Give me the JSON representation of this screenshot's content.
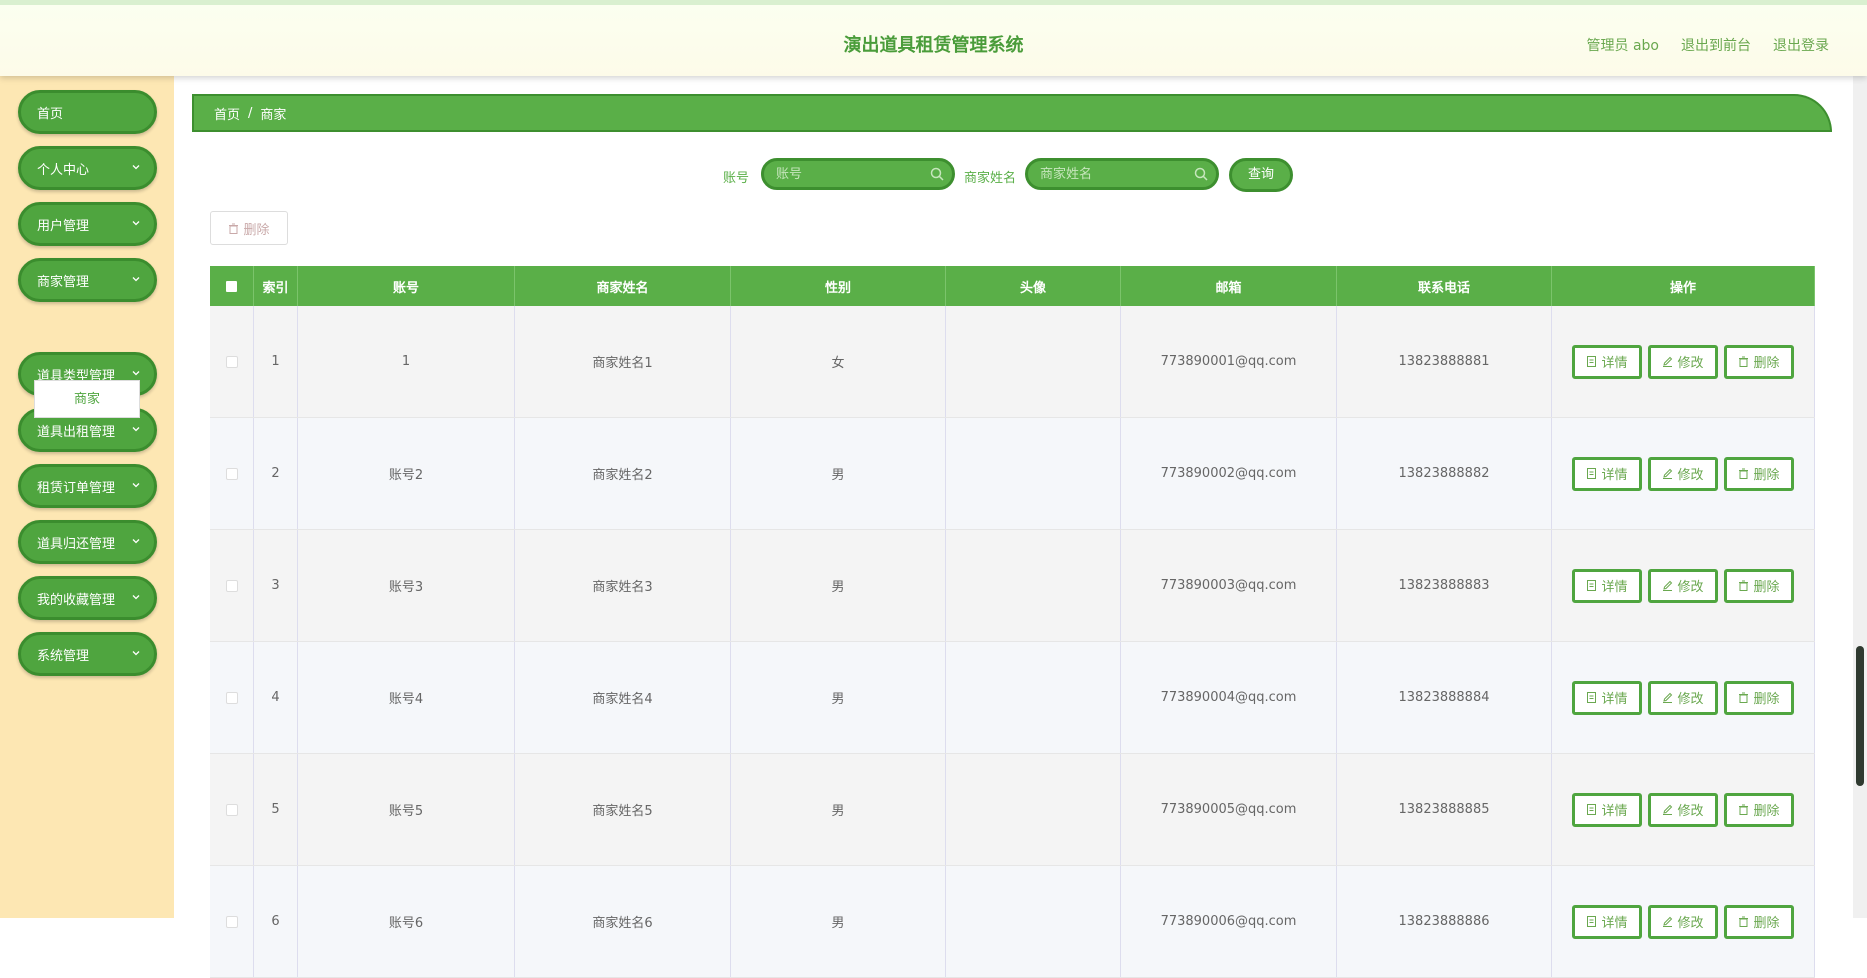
{
  "header": {
    "title": "演出道具租赁管理系统",
    "user_label": "管理员 abo",
    "front_link": "退出到前台",
    "logout_link": "退出登录"
  },
  "sidebar": {
    "items": [
      {
        "label": "首页",
        "has_arrow": false
      },
      {
        "label": "个人中心",
        "has_arrow": true
      },
      {
        "label": "用户管理",
        "has_arrow": true
      },
      {
        "label": "商家管理",
        "has_arrow": true
      },
      {
        "label": "道具类型管理",
        "has_arrow": true
      },
      {
        "label": "道具出租管理",
        "has_arrow": true
      },
      {
        "label": "租赁订单管理",
        "has_arrow": true
      },
      {
        "label": "道具归还管理",
        "has_arrow": true
      },
      {
        "label": "我的收藏管理",
        "has_arrow": true
      },
      {
        "label": "系统管理",
        "has_arrow": true
      }
    ],
    "submenu_label": "商家"
  },
  "breadcrumb": {
    "home": "首页",
    "sep": "/",
    "current": "商家"
  },
  "search": {
    "account_label": "账号",
    "account_placeholder": "账号",
    "name_label": "商家姓名",
    "name_placeholder": "商家姓名",
    "query_button": "查询"
  },
  "toolbar": {
    "delete_label": "删除"
  },
  "table": {
    "headers": [
      "索引",
      "账号",
      "商家姓名",
      "性别",
      "头像",
      "邮箱",
      "联系电话",
      "操作"
    ],
    "rows": [
      {
        "index": "1",
        "account": "1",
        "name": "商家姓名1",
        "gender": "女",
        "email": "773890001@qq.com",
        "phone": "13823888881"
      },
      {
        "index": "2",
        "account": "账号2",
        "name": "商家姓名2",
        "gender": "男",
        "email": "773890002@qq.com",
        "phone": "13823888882"
      },
      {
        "index": "3",
        "account": "账号3",
        "name": "商家姓名3",
        "gender": "男",
        "email": "773890003@qq.com",
        "phone": "13823888883"
      },
      {
        "index": "4",
        "account": "账号4",
        "name": "商家姓名4",
        "gender": "男",
        "email": "773890004@qq.com",
        "phone": "13823888884"
      },
      {
        "index": "5",
        "account": "账号5",
        "name": "商家姓名5",
        "gender": "男",
        "email": "773890005@qq.com",
        "phone": "13823888885"
      },
      {
        "index": "6",
        "account": "账号6",
        "name": "商家姓名6",
        "gender": "男",
        "email": "773890006@qq.com",
        "phone": "13823888886"
      }
    ],
    "actions": {
      "detail": "详情",
      "edit": "修改",
      "delete": "删除"
    }
  },
  "colors": {
    "primary": "#5aaf48",
    "primary_dark": "#3d8f2f",
    "sidebar_bg": "#fde7b3"
  }
}
